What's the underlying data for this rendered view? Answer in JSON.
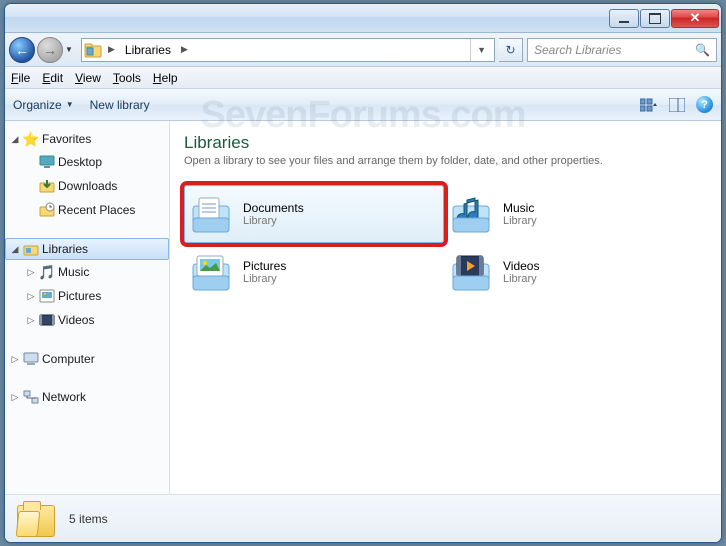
{
  "watermark": "SevenForums.com",
  "address": {
    "crumb": "Libraries"
  },
  "search": {
    "placeholder": "Search Libraries"
  },
  "menu": {
    "file": "File",
    "edit": "Edit",
    "view": "View",
    "tools": "Tools",
    "help": "Help"
  },
  "toolbar": {
    "organize": "Organize",
    "newlib": "New library"
  },
  "sidebar": {
    "favorites": {
      "label": "Favorites",
      "items": [
        {
          "label": "Desktop"
        },
        {
          "label": "Downloads"
        },
        {
          "label": "Recent Places"
        }
      ]
    },
    "libraries": {
      "label": "Libraries",
      "items": [
        {
          "label": "Music"
        },
        {
          "label": "Pictures"
        },
        {
          "label": "Videos"
        }
      ]
    },
    "computer": {
      "label": "Computer"
    },
    "network": {
      "label": "Network"
    }
  },
  "content": {
    "title": "Libraries",
    "subtitle": "Open a library to see your files and arrange them by folder, date, and other properties.",
    "items": [
      {
        "name": "Documents",
        "type": "Library",
        "selected": true,
        "highlighted": true,
        "icon": "documents"
      },
      {
        "name": "Music",
        "type": "Library",
        "icon": "music"
      },
      {
        "name": "Pictures",
        "type": "Library",
        "icon": "pictures"
      },
      {
        "name": "Videos",
        "type": "Library",
        "icon": "videos"
      }
    ]
  },
  "status": {
    "text": "5 items"
  }
}
